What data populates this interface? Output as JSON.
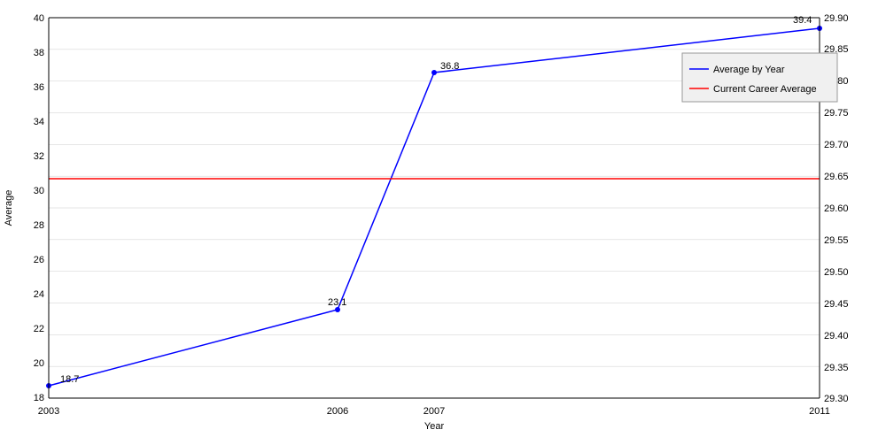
{
  "chart": {
    "title": "Average by Year",
    "left_axis_label": "Average",
    "bottom_axis_label": "Year",
    "left_y_min": 18,
    "left_y_max": 40,
    "right_y_min": 29.3,
    "right_y_max": 29.9,
    "x_ticks": [
      "2003",
      "2006",
      "2007",
      "2011"
    ],
    "left_y_ticks": [
      18,
      20,
      22,
      24,
      26,
      28,
      30,
      32,
      34,
      36,
      38,
      40
    ],
    "right_y_ticks": [
      29.3,
      29.35,
      29.4,
      29.45,
      29.5,
      29.55,
      29.6,
      29.65,
      29.7,
      29.75,
      29.8,
      29.85,
      29.9
    ],
    "data_points": [
      {
        "year": 2003,
        "value": 18.7
      },
      {
        "year": 2006,
        "value": 23.1
      },
      {
        "year": 2007,
        "value": 36.8
      },
      {
        "year": 2011,
        "value": 39.4
      }
    ],
    "career_average": 29.65,
    "legend": {
      "line1": "Average by Year",
      "line2": "Current Career Average"
    },
    "annotations": [
      {
        "year": 2003,
        "value": 18.7,
        "label": "18.7"
      },
      {
        "year": 2006,
        "value": 23.1,
        "label": "23.1"
      },
      {
        "year": 2007,
        "value": 36.8,
        "label": "36.8"
      },
      {
        "year": 2011,
        "value": 39.4,
        "label": "39.4"
      }
    ]
  }
}
